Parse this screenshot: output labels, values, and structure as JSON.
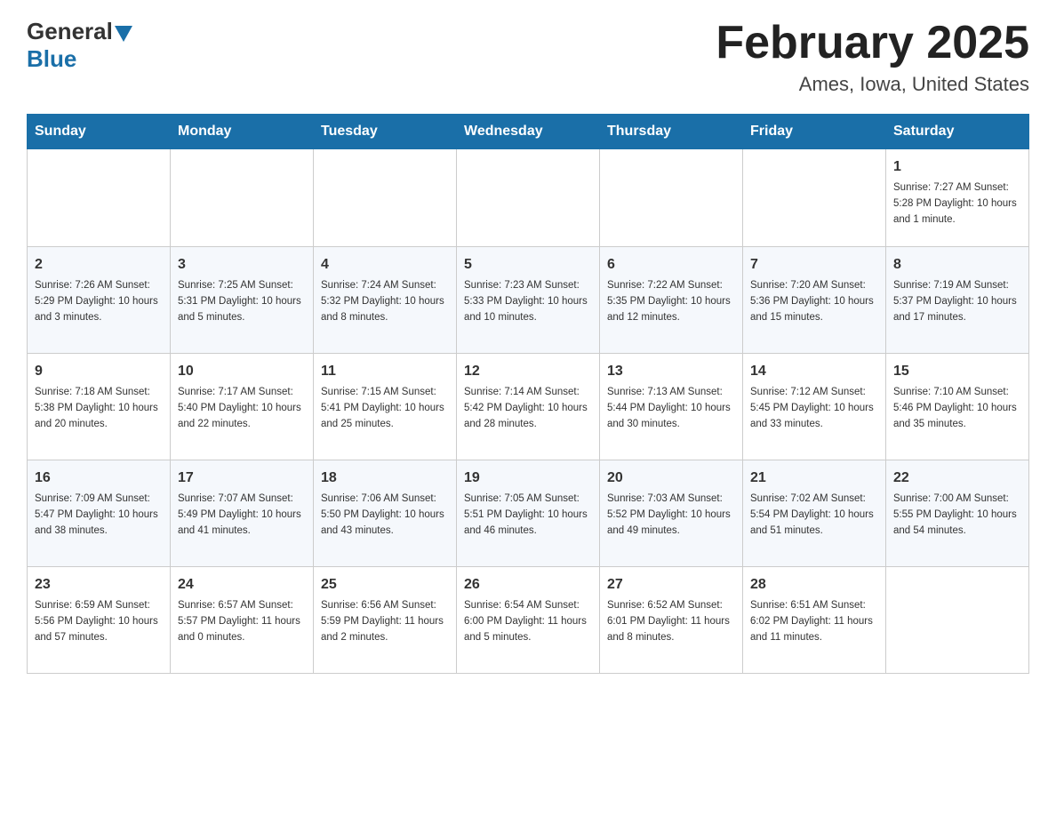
{
  "header": {
    "logo": {
      "text_general": "General",
      "text_blue": "Blue"
    },
    "title": "February 2025",
    "subtitle": "Ames, Iowa, United States"
  },
  "days_of_week": [
    "Sunday",
    "Monday",
    "Tuesday",
    "Wednesday",
    "Thursday",
    "Friday",
    "Saturday"
  ],
  "weeks": [
    {
      "days": [
        {
          "number": "",
          "info": ""
        },
        {
          "number": "",
          "info": ""
        },
        {
          "number": "",
          "info": ""
        },
        {
          "number": "",
          "info": ""
        },
        {
          "number": "",
          "info": ""
        },
        {
          "number": "",
          "info": ""
        },
        {
          "number": "1",
          "info": "Sunrise: 7:27 AM\nSunset: 5:28 PM\nDaylight: 10 hours and 1 minute."
        }
      ]
    },
    {
      "days": [
        {
          "number": "2",
          "info": "Sunrise: 7:26 AM\nSunset: 5:29 PM\nDaylight: 10 hours and 3 minutes."
        },
        {
          "number": "3",
          "info": "Sunrise: 7:25 AM\nSunset: 5:31 PM\nDaylight: 10 hours and 5 minutes."
        },
        {
          "number": "4",
          "info": "Sunrise: 7:24 AM\nSunset: 5:32 PM\nDaylight: 10 hours and 8 minutes."
        },
        {
          "number": "5",
          "info": "Sunrise: 7:23 AM\nSunset: 5:33 PM\nDaylight: 10 hours and 10 minutes."
        },
        {
          "number": "6",
          "info": "Sunrise: 7:22 AM\nSunset: 5:35 PM\nDaylight: 10 hours and 12 minutes."
        },
        {
          "number": "7",
          "info": "Sunrise: 7:20 AM\nSunset: 5:36 PM\nDaylight: 10 hours and 15 minutes."
        },
        {
          "number": "8",
          "info": "Sunrise: 7:19 AM\nSunset: 5:37 PM\nDaylight: 10 hours and 17 minutes."
        }
      ]
    },
    {
      "days": [
        {
          "number": "9",
          "info": "Sunrise: 7:18 AM\nSunset: 5:38 PM\nDaylight: 10 hours and 20 minutes."
        },
        {
          "number": "10",
          "info": "Sunrise: 7:17 AM\nSunset: 5:40 PM\nDaylight: 10 hours and 22 minutes."
        },
        {
          "number": "11",
          "info": "Sunrise: 7:15 AM\nSunset: 5:41 PM\nDaylight: 10 hours and 25 minutes."
        },
        {
          "number": "12",
          "info": "Sunrise: 7:14 AM\nSunset: 5:42 PM\nDaylight: 10 hours and 28 minutes."
        },
        {
          "number": "13",
          "info": "Sunrise: 7:13 AM\nSunset: 5:44 PM\nDaylight: 10 hours and 30 minutes."
        },
        {
          "number": "14",
          "info": "Sunrise: 7:12 AM\nSunset: 5:45 PM\nDaylight: 10 hours and 33 minutes."
        },
        {
          "number": "15",
          "info": "Sunrise: 7:10 AM\nSunset: 5:46 PM\nDaylight: 10 hours and 35 minutes."
        }
      ]
    },
    {
      "days": [
        {
          "number": "16",
          "info": "Sunrise: 7:09 AM\nSunset: 5:47 PM\nDaylight: 10 hours and 38 minutes."
        },
        {
          "number": "17",
          "info": "Sunrise: 7:07 AM\nSunset: 5:49 PM\nDaylight: 10 hours and 41 minutes."
        },
        {
          "number": "18",
          "info": "Sunrise: 7:06 AM\nSunset: 5:50 PM\nDaylight: 10 hours and 43 minutes."
        },
        {
          "number": "19",
          "info": "Sunrise: 7:05 AM\nSunset: 5:51 PM\nDaylight: 10 hours and 46 minutes."
        },
        {
          "number": "20",
          "info": "Sunrise: 7:03 AM\nSunset: 5:52 PM\nDaylight: 10 hours and 49 minutes."
        },
        {
          "number": "21",
          "info": "Sunrise: 7:02 AM\nSunset: 5:54 PM\nDaylight: 10 hours and 51 minutes."
        },
        {
          "number": "22",
          "info": "Sunrise: 7:00 AM\nSunset: 5:55 PM\nDaylight: 10 hours and 54 minutes."
        }
      ]
    },
    {
      "days": [
        {
          "number": "23",
          "info": "Sunrise: 6:59 AM\nSunset: 5:56 PM\nDaylight: 10 hours and 57 minutes."
        },
        {
          "number": "24",
          "info": "Sunrise: 6:57 AM\nSunset: 5:57 PM\nDaylight: 11 hours and 0 minutes."
        },
        {
          "number": "25",
          "info": "Sunrise: 6:56 AM\nSunset: 5:59 PM\nDaylight: 11 hours and 2 minutes."
        },
        {
          "number": "26",
          "info": "Sunrise: 6:54 AM\nSunset: 6:00 PM\nDaylight: 11 hours and 5 minutes."
        },
        {
          "number": "27",
          "info": "Sunrise: 6:52 AM\nSunset: 6:01 PM\nDaylight: 11 hours and 8 minutes."
        },
        {
          "number": "28",
          "info": "Sunrise: 6:51 AM\nSunset: 6:02 PM\nDaylight: 11 hours and 11 minutes."
        },
        {
          "number": "",
          "info": ""
        }
      ]
    }
  ]
}
